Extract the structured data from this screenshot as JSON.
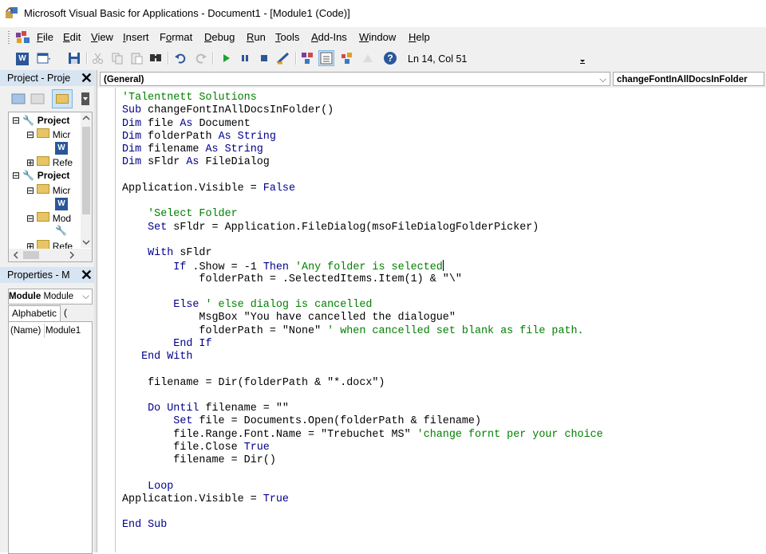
{
  "window": {
    "title": "Microsoft Visual Basic for Applications - Document1 - [Module1 (Code)]"
  },
  "menu": {
    "items": [
      {
        "key": "file",
        "pre": "",
        "ul": "F",
        "post": "ile"
      },
      {
        "key": "edit",
        "pre": "",
        "ul": "E",
        "post": "dit"
      },
      {
        "key": "view",
        "pre": "",
        "ul": "V",
        "post": "iew"
      },
      {
        "key": "insert",
        "pre": "",
        "ul": "I",
        "post": "nsert"
      },
      {
        "key": "format",
        "pre": "F",
        "ul": "o",
        "post": "rmat"
      },
      {
        "key": "debug",
        "pre": "",
        "ul": "D",
        "post": "ebug"
      },
      {
        "key": "run",
        "pre": "",
        "ul": "R",
        "post": "un"
      },
      {
        "key": "tools",
        "pre": "",
        "ul": "T",
        "post": "ools"
      },
      {
        "key": "addins",
        "pre": "",
        "ul": "A",
        "post": "dd-Ins"
      },
      {
        "key": "window",
        "pre": "",
        "ul": "W",
        "post": "indow"
      },
      {
        "key": "help",
        "pre": "",
        "ul": "H",
        "post": "elp"
      }
    ]
  },
  "toolbar": {
    "status": "Ln 14, Col 51"
  },
  "project": {
    "title": "Project - Proje",
    "tree": [
      {
        "label": "Project",
        "bold": true,
        "icon": "project-icon"
      },
      {
        "label": "Micr",
        "bold": false,
        "icon": "folder-icon"
      },
      {
        "label": "",
        "bold": false,
        "icon": "word-doc-icon"
      },
      {
        "label": "Refe",
        "bold": false,
        "icon": "folder-icon"
      },
      {
        "label": "Project",
        "bold": true,
        "icon": "project-icon"
      },
      {
        "label": "Micr",
        "bold": false,
        "icon": "folder-icon"
      },
      {
        "label": "",
        "bold": false,
        "icon": "word-doc-icon"
      },
      {
        "label": "Mod",
        "bold": false,
        "icon": "folder-icon"
      },
      {
        "label": "",
        "bold": false,
        "icon": "module-icon"
      },
      {
        "label": "Refe",
        "bold": false,
        "icon": "folder-icon"
      }
    ]
  },
  "properties": {
    "title": "Properties - M",
    "object_bold": "Module",
    "object_rest": "Module",
    "tab_alpha": "Alphabetic",
    "tab_cat": "(",
    "row_name": "(Name)",
    "row_value": "Module1"
  },
  "code_window": {
    "object_combo": "(General)",
    "proc_combo": "changeFontInAllDocsInFolder",
    "lines": [
      [
        {
          "t": "'Talentnett Solutions",
          "c": "cm"
        }
      ],
      [
        {
          "t": "Sub ",
          "c": "kw"
        },
        {
          "t": "changeFontInAllDocsInFolder()",
          "c": ""
        }
      ],
      [
        {
          "t": "Dim ",
          "c": "kw"
        },
        {
          "t": "file ",
          "c": ""
        },
        {
          "t": "As ",
          "c": "kw"
        },
        {
          "t": "Document",
          "c": ""
        }
      ],
      [
        {
          "t": "Dim ",
          "c": "kw"
        },
        {
          "t": "folderPath ",
          "c": ""
        },
        {
          "t": "As String",
          "c": "kw"
        }
      ],
      [
        {
          "t": "Dim ",
          "c": "kw"
        },
        {
          "t": "filename ",
          "c": ""
        },
        {
          "t": "As String",
          "c": "kw"
        }
      ],
      [
        {
          "t": "Dim ",
          "c": "kw"
        },
        {
          "t": "sFldr ",
          "c": ""
        },
        {
          "t": "As ",
          "c": "kw"
        },
        {
          "t": "FileDialog",
          "c": ""
        }
      ],
      [],
      [
        {
          "t": "Application.Visible = ",
          "c": ""
        },
        {
          "t": "False",
          "c": "kw"
        }
      ],
      [],
      [
        {
          "t": "    'Select Folder",
          "c": "cm"
        }
      ],
      [
        {
          "t": "    Set ",
          "c": "kw"
        },
        {
          "t": "sFldr = Application.FileDialog(msoFileDialogFolderPicker)",
          "c": ""
        }
      ],
      [],
      [
        {
          "t": "    With ",
          "c": "kw"
        },
        {
          "t": "sFldr",
          "c": ""
        }
      ],
      [
        {
          "t": "        If ",
          "c": "kw"
        },
        {
          "t": ".Show = -1 ",
          "c": ""
        },
        {
          "t": "Then ",
          "c": "kw"
        },
        {
          "t": "'Any folder is selected",
          "c": "cm"
        },
        {
          "t": "",
          "c": "cursor"
        }
      ],
      [
        {
          "t": "            folderPath = .SelectedItems.Item(1) & \"\\\"",
          "c": ""
        }
      ],
      [],
      [
        {
          "t": "        Else ",
          "c": "kw"
        },
        {
          "t": "' else dialog is cancelled",
          "c": "cm"
        }
      ],
      [
        {
          "t": "            MsgBox \"You have cancelled the dialogue\"",
          "c": ""
        }
      ],
      [
        {
          "t": "            folderPath = \"None\" ",
          "c": ""
        },
        {
          "t": "' when cancelled set blank as file path.",
          "c": "cm"
        }
      ],
      [
        {
          "t": "        End If",
          "c": "kw"
        }
      ],
      [
        {
          "t": "   End With",
          "c": "kw"
        }
      ],
      [],
      [
        {
          "t": "    filename = Dir(folderPath & \"*.docx\")",
          "c": ""
        }
      ],
      [],
      [
        {
          "t": "    Do Until ",
          "c": "kw"
        },
        {
          "t": "filename = \"\"",
          "c": ""
        }
      ],
      [
        {
          "t": "        Set ",
          "c": "kw"
        },
        {
          "t": "file = Documents.Open(folderPath & filename)",
          "c": ""
        }
      ],
      [
        {
          "t": "        file.Range.Font.Name = \"Trebuchet MS\" ",
          "c": ""
        },
        {
          "t": "'change fornt per your choice",
          "c": "cm"
        }
      ],
      [
        {
          "t": "        file.Close ",
          "c": ""
        },
        {
          "t": "True",
          "c": "kw"
        }
      ],
      [
        {
          "t": "        filename = Dir()",
          "c": ""
        }
      ],
      [],
      [
        {
          "t": "    Loop",
          "c": "kw"
        }
      ],
      [
        {
          "t": "Application.Visible = ",
          "c": ""
        },
        {
          "t": "True",
          "c": "kw"
        }
      ],
      [],
      [
        {
          "t": "End Sub",
          "c": "kw"
        }
      ]
    ]
  }
}
